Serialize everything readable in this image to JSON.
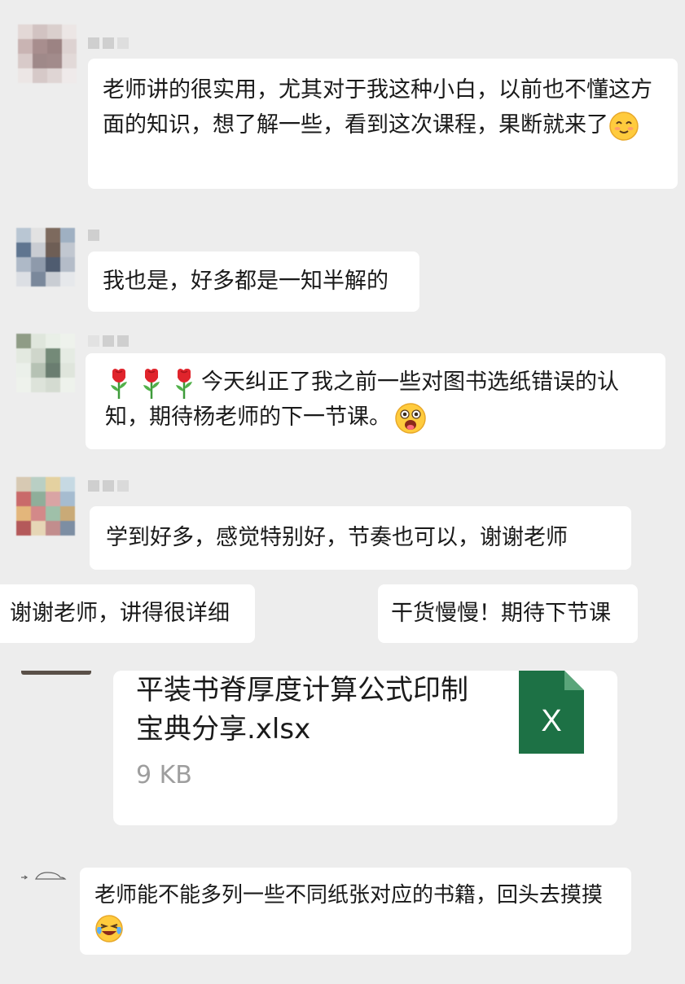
{
  "messages": [
    {
      "text": "老师讲的很实用，尤其对于我这种小白，以前也不懂这方面的知识，想了解一些，看到这次课程，果断就来了",
      "trailing_emoji": "smiling-blush-emoji"
    },
    {
      "text": "我也是，好多都是一知半解的"
    },
    {
      "leading_emoji": "rose-emoji",
      "text": "今天纠正了我之前一些对图书选纸错误的认知，期待杨老师的下一节课。",
      "trailing_emoji": "excited-face-emoji"
    },
    {
      "text": "学到好多，感觉特别好，节奏也可以，谢谢老师"
    },
    {
      "text": "谢谢老师，讲得很详细"
    },
    {
      "text": "干货慢慢！期待下节课"
    },
    {
      "text": "老师能不能多列一些不同纸张对应的书籍，回头去摸摸",
      "trailing_emoji": "laughing-tears-emoji"
    }
  ],
  "file": {
    "name": "平装书脊厚度计算公式印制宝典分享.xlsx",
    "size": "9 KB",
    "icon_letter": "X",
    "icon_color": "#1d7145"
  },
  "colors": {
    "background": "#ededed",
    "bubble": "#ffffff",
    "text": "#1a1a1a",
    "muted": "#9e9e9e"
  }
}
